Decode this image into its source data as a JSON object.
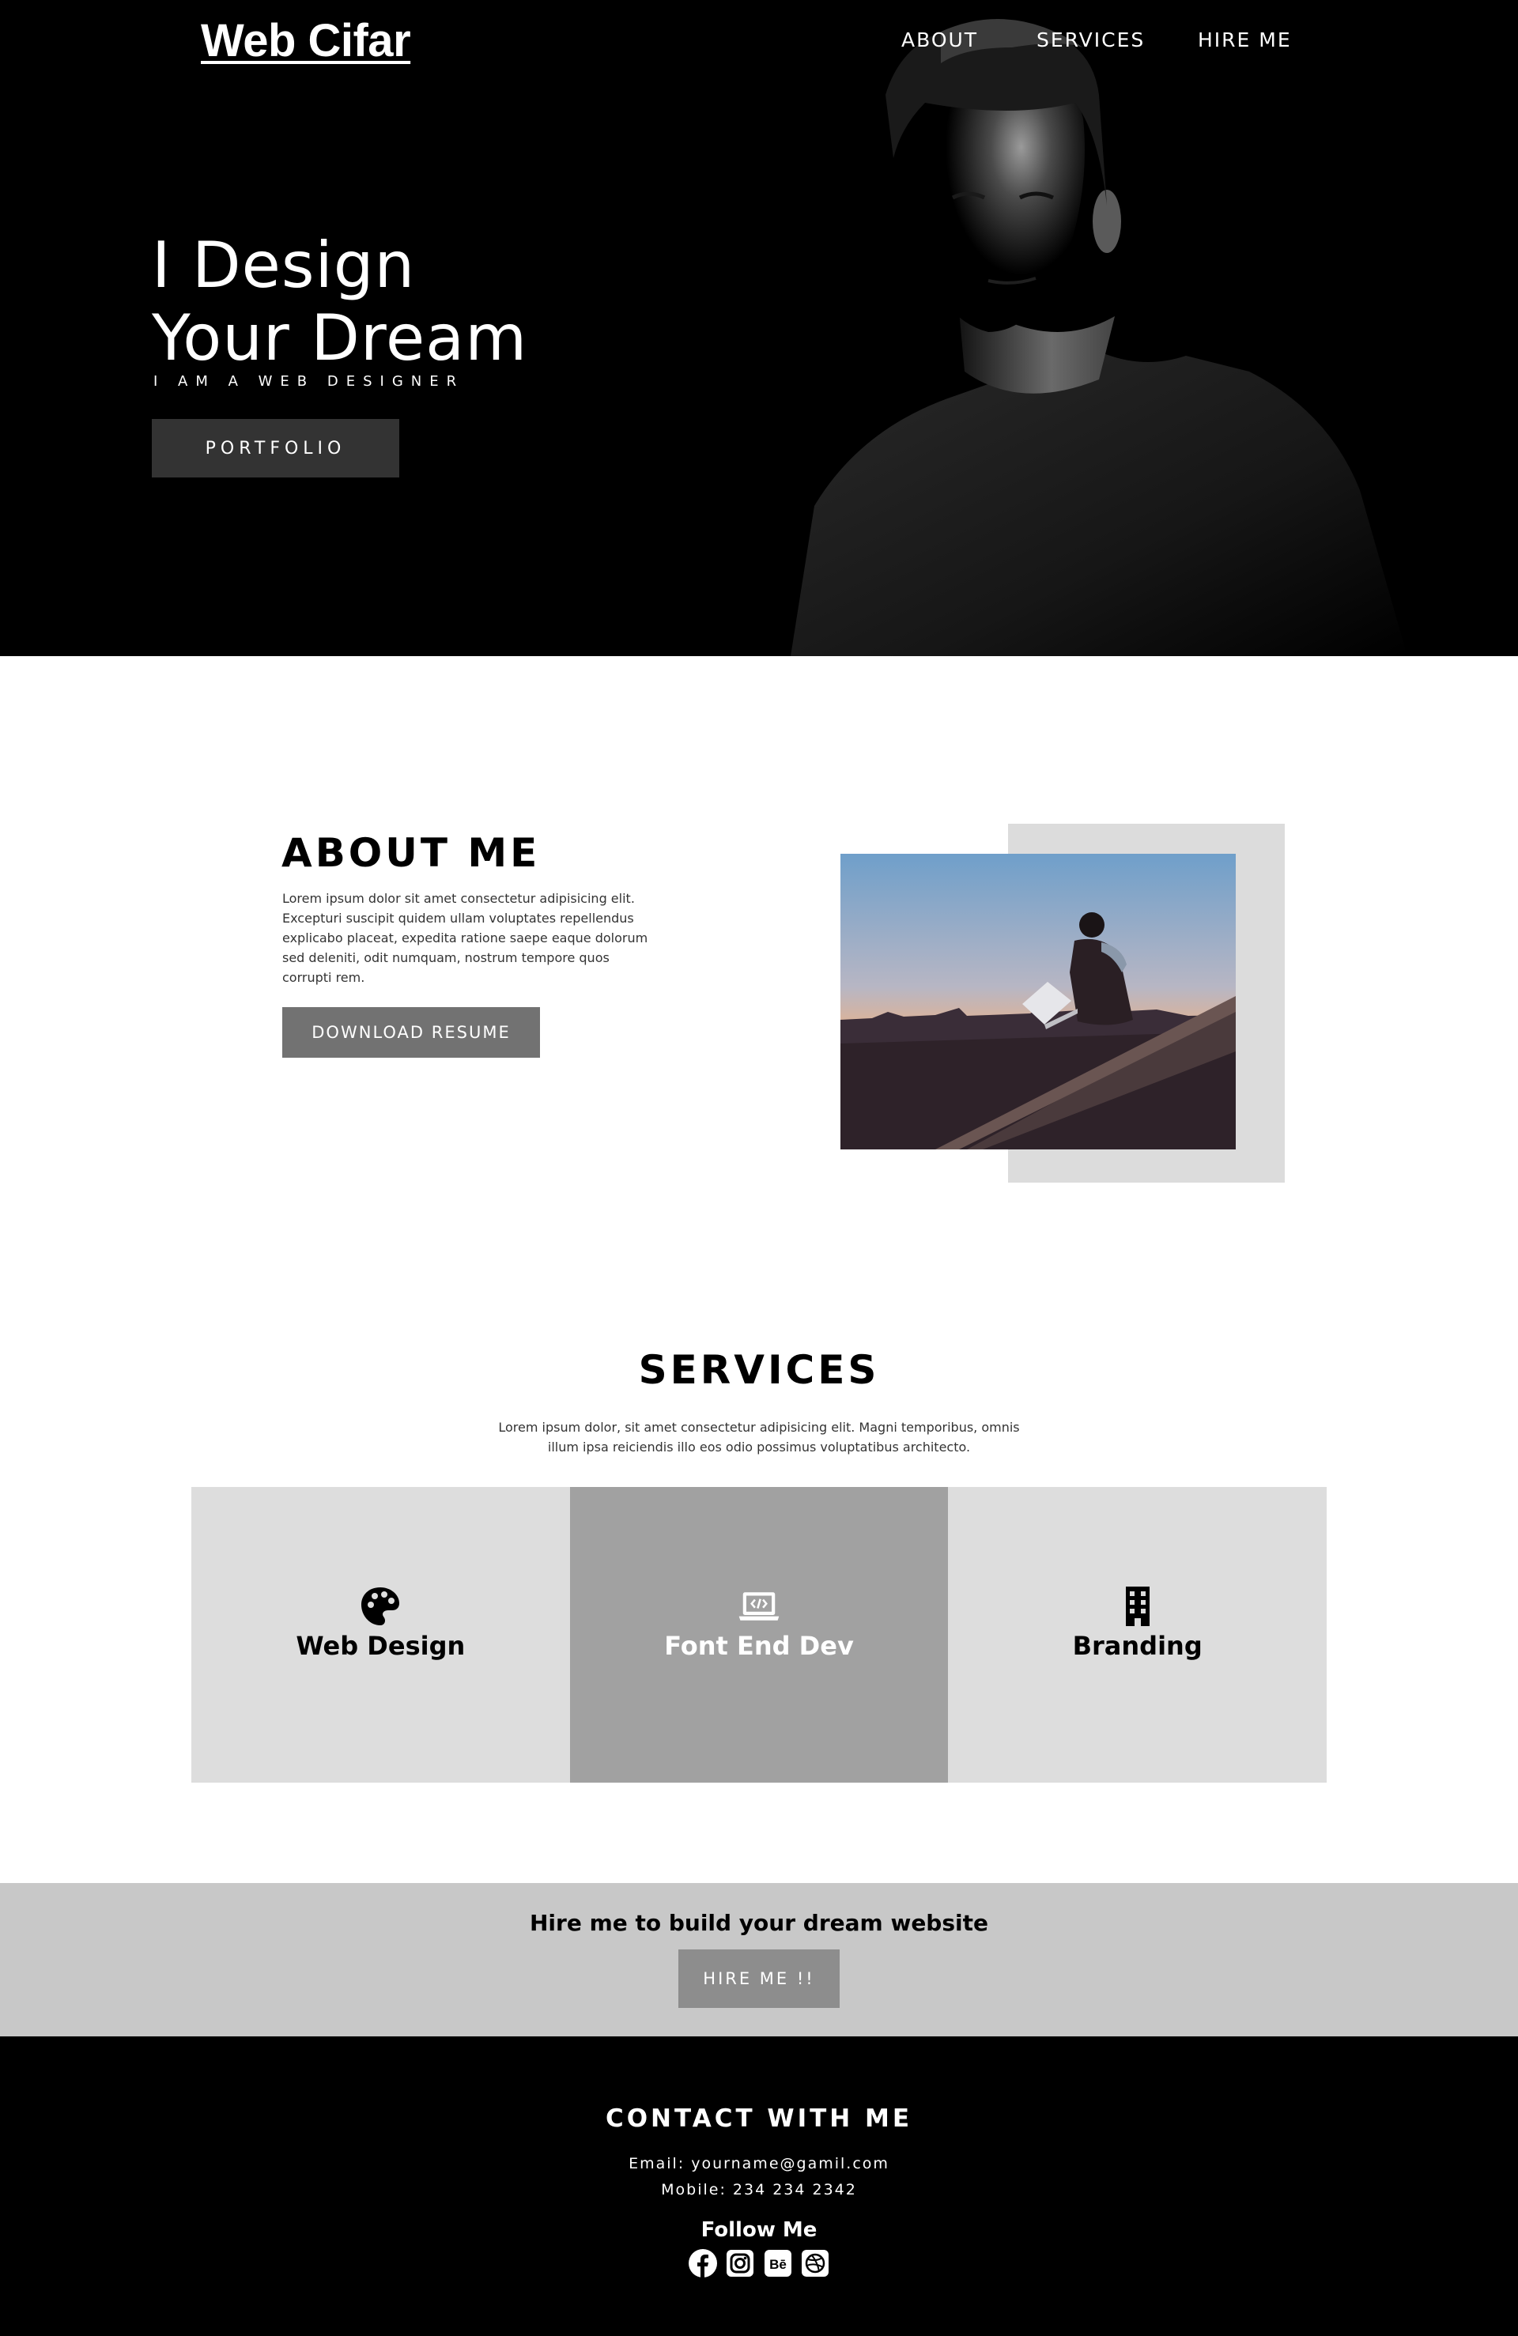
{
  "header": {
    "brand": "Web Cifar",
    "nav": [
      "ABOUT",
      "SERVICES",
      "HIRE ME"
    ]
  },
  "hero": {
    "title_line1": "I Design",
    "title_line2": "Your Dream",
    "subtitle": "I AM A WEB DESIGNER",
    "portfolio_label": "PORTFOLIO"
  },
  "about": {
    "title": "ABOUT ME",
    "text": "Lorem ipsum dolor sit amet consectetur adipisicing elit. Excepturi suscipit quidem ullam voluptates repellendus explicabo placeat, expedita ratione saepe eaque dolorum sed deleniti, odit numquam, nostrum tempore quos corrupti rem.",
    "resume_label": "DOWNLOAD RESUME"
  },
  "services": {
    "title": "SERVICES",
    "text": "Lorem ipsum dolor, sit amet consectetur adipisicing elit. Magni temporibus, omnis illum ipsa reiciendis illo eos odio possimus voluptatibus architecto.",
    "cards": [
      {
        "label": "Web Design",
        "icon": "palette-icon"
      },
      {
        "label": "Font End Dev",
        "icon": "laptop-code-icon"
      },
      {
        "label": "Branding",
        "icon": "building-icon"
      }
    ]
  },
  "hire": {
    "heading": "Hire me to build your dream website",
    "button_label": "HIRE ME !!"
  },
  "footer": {
    "title": "CONTACT WITH ME",
    "email": "Email: yourname@gamil.com",
    "mobile": "Mobile: 234 234 2342",
    "follow": "Follow Me",
    "socials": [
      "facebook-icon",
      "instagram-icon",
      "behance-icon",
      "dribbble-icon"
    ]
  },
  "colors": {
    "hero_bg": "#000000",
    "button_dark": "#333333",
    "card_light": "#dddddd",
    "card_mid": "#a1a1a1",
    "hire_band": "#c8c8c8"
  }
}
